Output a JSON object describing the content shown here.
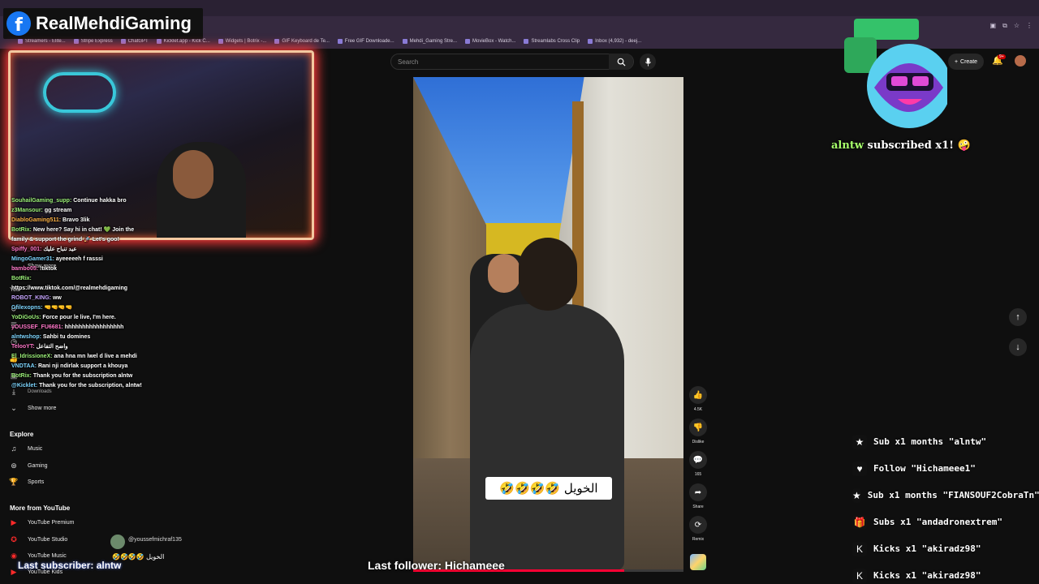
{
  "overlay": {
    "fb_name": "RealMehdiGaming",
    "alert": {
      "user": "alntw",
      "text": "subscribed x1!",
      "emoji": "🤪"
    },
    "last_subscriber": "Last subscriber: alntw",
    "last_follower": "Last follower: Hichameee",
    "caption": "الخويل 🤣🤣🤣🤣"
  },
  "bookmarks": [
    "Streamers - Elite...",
    "Stripe Express",
    "ChatGPT",
    "Kicklet.app - Kick C...",
    "Widgets | Botrix -...",
    "GIF Keyboard de Te...",
    "Free GIF Downloade...",
    "Mehdi_Gaming Stre...",
    "MovieBox - Watch...",
    "Streamlabs Cross Clip",
    "Inbox (4,932) - deej..."
  ],
  "chat": [
    {
      "user": "SouhailGaming_supp:",
      "msg": "Continue hakka bro",
      "c": "u1"
    },
    {
      "user": "z3Mansour:",
      "msg": "gg stream",
      "c": "u1"
    },
    {
      "user": "DiabloGaming511:",
      "msg": "Bravo 3lik",
      "c": "u3"
    },
    {
      "user": "BotRix:",
      "msg": "New here? Say hi in chat! 💚 Join the",
      "c": "u1"
    },
    {
      "user": "",
      "msg": "family & support the grind 🚀 Let's goo!",
      "c": "u1"
    },
    {
      "user": "Spiffy_001:",
      "msg": "عيد تنباح عليك",
      "c": "u4"
    },
    {
      "user": "MingoGamer31:",
      "msg": "ayeeeeeh f rasssi",
      "c": "u2"
    },
    {
      "user": "bambo05:",
      "msg": "!tiktok",
      "c": "u4"
    },
    {
      "user": "BotRix:",
      "msg": "",
      "c": "u1"
    },
    {
      "user": "",
      "msg": "https://www.tiktok.com/@realmehdigaming",
      "c": "u1"
    },
    {
      "user": "ROBOT_KING:",
      "msg": "ww",
      "c": "u5"
    },
    {
      "user": "Gfilexopns:",
      "msg": "🤜🤜🤜🤜",
      "c": "u2"
    },
    {
      "user": "YoDiGoUs:",
      "msg": "Force pour le live, I'm here.",
      "c": "u1"
    },
    {
      "user": "yOUSSEF_FU6681:",
      "msg": "hhhhhhhhhhhhhhhhh",
      "c": "u4"
    },
    {
      "user": "alntwshop:",
      "msg": "Sahbi tu domines",
      "c": "u2"
    },
    {
      "user": "TelooYT:",
      "msg": "واضح التفاعل",
      "c": "u4"
    },
    {
      "user": "El_IdrissioneX:",
      "msg": "ana hna mn lwel d live a mehdi",
      "c": "u1"
    },
    {
      "user": "VNDTAA:",
      "msg": "Rani nji ndirlak support a khouya",
      "c": "u2"
    },
    {
      "user": "BotRix:",
      "msg": "Thank you for the subscription alntw",
      "c": "u1"
    },
    {
      "user": "@Kicklet:",
      "msg": "Thank you for the subscription, alntw!",
      "c": "u2"
    }
  ],
  "youtube": {
    "search_placeholder": "Search",
    "create_label": "Create",
    "notif_count": "9+",
    "like_count": "4.5K",
    "dislike_label": "Dislike",
    "comment_count": "165",
    "share_label": "Share",
    "remix_label": "Remix",
    "sidebar": {
      "show_more_1": "Show more",
      "show_more_2": "Show more",
      "you": "You",
      "downloads": "Downloads",
      "explore_head": "Explore",
      "explore": [
        "Music",
        "Gaming",
        "Sports"
      ],
      "more_head": "More from YouTube",
      "more": [
        "YouTube Premium",
        "YouTube Studio",
        "YouTube Music",
        "YouTube Kids"
      ]
    },
    "comment": {
      "user": "@youssefmichraf135",
      "text": "الخويل 🤣🤣🤣🤣"
    }
  },
  "progress_fraction": 0.78,
  "events": [
    {
      "icon": "★",
      "text": "Sub x1 months \"alntw\""
    },
    {
      "icon": "♥",
      "text": "Follow \"Hichameee1\""
    },
    {
      "icon": "★",
      "text": "Sub x1 months \"FIANSOUF2CobraTn\""
    },
    {
      "icon": "🎁",
      "text": "Subs x1 \"andadronextrem\""
    },
    {
      "icon": "K",
      "text": "Kicks x1 \"akiradz98\""
    },
    {
      "icon": "K",
      "text": "Kicks x1 \"akiradz98\""
    }
  ]
}
